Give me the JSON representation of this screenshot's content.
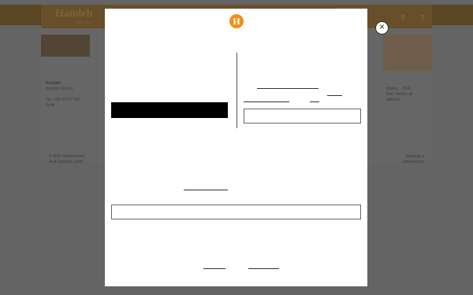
{
  "background": {
    "logo": "Hamleh",
    "logo_sub": "Ány Ísi",
    "top_link": "Hlébosok | Kefer",
    "icon_1": "?",
    "icon_2": "?",
    "left_heading": "Kontakt",
    "left_lines": [
      "Kontakt 13 perc",
      "Tel.: +81 22377 667",
      "Iroda"
    ],
    "right_lines": [
      "Nyitva... 2020",
      "Fed. Valódi csk",
      "Adóvim."
    ],
    "footer_left": [
      "© 2024 Hamlehidom",
      "Áruk kiválóbb, jótáll"
    ],
    "footer_right": [
      "Segítség a",
      "Elérhetőség"
    ]
  },
  "modal": {
    "logo_letter": "H",
    "close_label": "×"
  }
}
